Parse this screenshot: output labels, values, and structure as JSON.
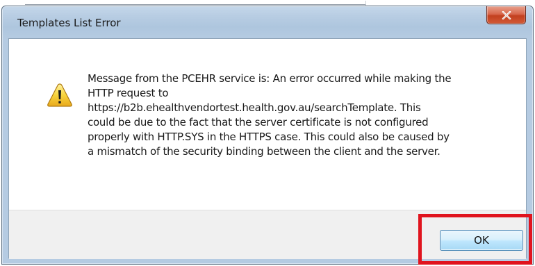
{
  "dialog": {
    "title": "Templates List Error",
    "close_icon": "close-icon",
    "warning_icon": "warning-icon",
    "message": "Message from the PCEHR service is: An error occurred while making the\nHTTP request to\nhttps://b2b.ehealthvendortest.health.gov.au/searchTemplate. This\ncould be due to the fact that the server certificate is not configured\nproperly with HTTP.SYS in the HTTPS case. This could also be caused by\na mismatch of the security binding between the client and the server.",
    "ok_label": "OK"
  },
  "colors": {
    "highlight": "#e0141e",
    "close_button": "#c2401f",
    "title_bar": "#b8cde3"
  }
}
